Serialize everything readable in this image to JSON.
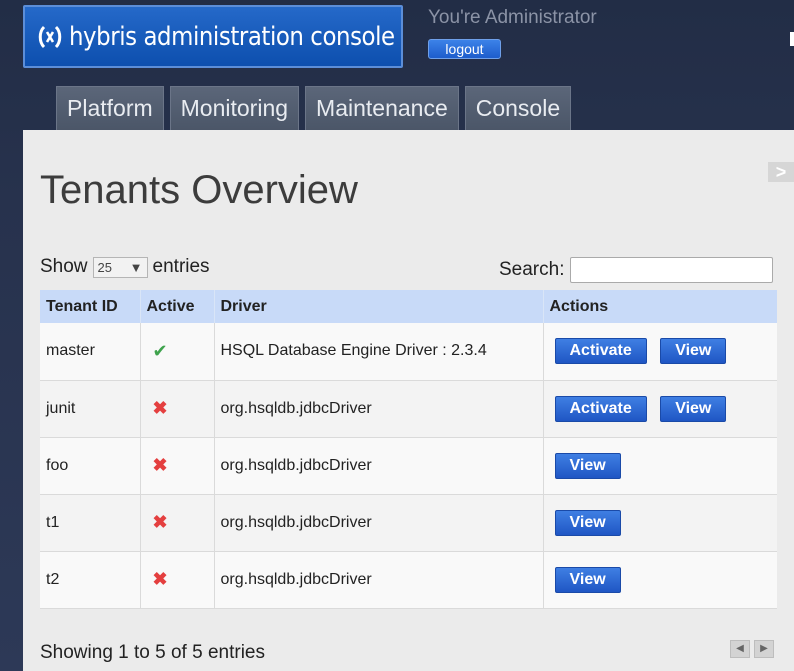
{
  "header": {
    "app_title": "hybris administration console",
    "user_text": "You're Administrator",
    "logout_label": "logout"
  },
  "nav": {
    "tabs": [
      {
        "label": "Platform"
      },
      {
        "label": "Monitoring"
      },
      {
        "label": "Maintenance"
      },
      {
        "label": "Console"
      }
    ]
  },
  "main": {
    "title": "Tenants Overview",
    "side_toggle": ">",
    "show_label": "Show",
    "page_length": "25",
    "entries_label": "entries",
    "search_label": "Search:",
    "search_value": "",
    "columns": [
      "Tenant ID",
      "Active",
      "Driver",
      "Actions"
    ],
    "rows": [
      {
        "id": "master",
        "active": true,
        "driver": "HSQL Database Engine Driver : 2.3.4",
        "actions": [
          "Activate",
          "View"
        ]
      },
      {
        "id": "junit",
        "active": false,
        "driver": "org.hsqldb.jdbcDriver",
        "actions": [
          "Activate",
          "View"
        ]
      },
      {
        "id": "foo",
        "active": false,
        "driver": "org.hsqldb.jdbcDriver",
        "actions": [
          "View"
        ]
      },
      {
        "id": "t1",
        "active": false,
        "driver": "org.hsqldb.jdbcDriver",
        "actions": [
          "View"
        ]
      },
      {
        "id": "t2",
        "active": false,
        "driver": "org.hsqldb.jdbcDriver",
        "actions": [
          "View"
        ]
      }
    ],
    "info": "Showing 1 to 5 of 5 entries"
  },
  "colors": {
    "accent_blue": "#1f56c4",
    "header_bg": "#222d46",
    "active_green": "#3fa34d",
    "inactive_red": "#e43f3f"
  }
}
